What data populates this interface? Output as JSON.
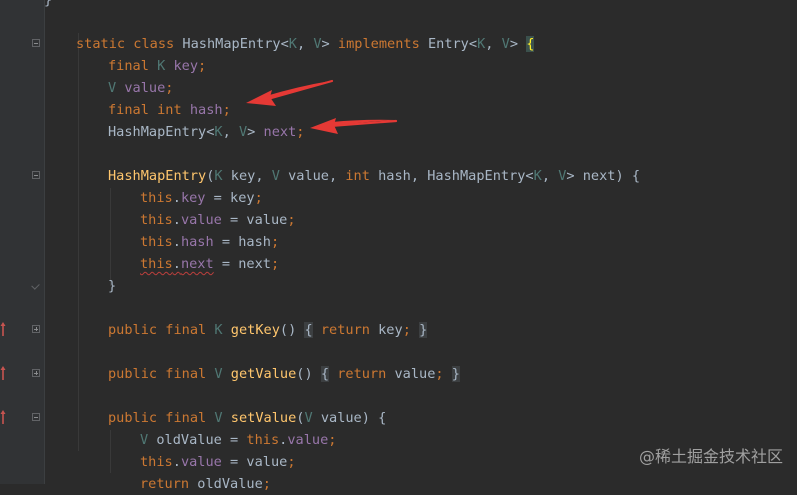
{
  "editor": {
    "language": "java",
    "lines": [
      {
        "tokens": [
          {
            "t": "}",
            "c": "t-brace"
          }
        ]
      },
      {
        "tokens": []
      },
      {
        "fold": "minus",
        "tokens": [
          {
            "t": "static",
            "c": "t-kw"
          },
          {
            "t": " "
          },
          {
            "t": "class",
            "c": "t-kw"
          },
          {
            "t": " HashMapEntry<"
          },
          {
            "t": "K",
            "c": "t-tp"
          },
          {
            "t": ", "
          },
          {
            "t": "V",
            "c": "t-tp"
          },
          {
            "t": "> "
          },
          {
            "t": "implements",
            "c": "t-kw"
          },
          {
            "t": " Entry<"
          },
          {
            "t": "K",
            "c": "t-tp"
          },
          {
            "t": ", "
          },
          {
            "t": "V",
            "c": "t-tp"
          },
          {
            "t": "> "
          },
          {
            "t": "{",
            "c": "t-hl"
          }
        ]
      },
      {
        "tokens": [
          {
            "t": "final",
            "c": "t-kw"
          },
          {
            "t": " "
          },
          {
            "t": "K",
            "c": "t-tp"
          },
          {
            "t": " "
          },
          {
            "t": "key",
            "c": "t-field"
          },
          {
            "t": ";",
            "c": "t-kw"
          }
        ]
      },
      {
        "tokens": [
          {
            "t": "V",
            "c": "t-tp"
          },
          {
            "t": " "
          },
          {
            "t": "value",
            "c": "t-field"
          },
          {
            "t": ";",
            "c": "t-kw"
          }
        ]
      },
      {
        "tokens": [
          {
            "t": "final",
            "c": "t-kw"
          },
          {
            "t": " "
          },
          {
            "t": "int",
            "c": "t-kw"
          },
          {
            "t": " "
          },
          {
            "t": "hash",
            "c": "t-field"
          },
          {
            "t": ";",
            "c": "t-kw"
          }
        ]
      },
      {
        "tokens": [
          {
            "t": "HashMapEntry<"
          },
          {
            "t": "K",
            "c": "t-tp"
          },
          {
            "t": ", "
          },
          {
            "t": "V",
            "c": "t-tp"
          },
          {
            "t": "> "
          },
          {
            "t": "next",
            "c": "t-field"
          },
          {
            "t": ";",
            "c": "t-kw"
          }
        ]
      },
      {
        "tokens": []
      },
      {
        "fold": "minus",
        "tokens": [
          {
            "t": "HashMapEntry",
            "c": "t-fn"
          },
          {
            "t": "("
          },
          {
            "t": "K",
            "c": "t-tp"
          },
          {
            "t": " key, "
          },
          {
            "t": "V",
            "c": "t-tp"
          },
          {
            "t": " value, "
          },
          {
            "t": "int",
            "c": "t-kw"
          },
          {
            "t": " hash, HashMapEntry<"
          },
          {
            "t": "K",
            "c": "t-tp"
          },
          {
            "t": ", "
          },
          {
            "t": "V",
            "c": "t-tp"
          },
          {
            "t": "> next) {"
          }
        ]
      },
      {
        "tokens": [
          {
            "t": "this",
            "c": "t-kw"
          },
          {
            "t": "."
          },
          {
            "t": "key",
            "c": "t-field"
          },
          {
            "t": " = key"
          },
          {
            "t": ";",
            "c": "t-kw"
          }
        ]
      },
      {
        "tokens": [
          {
            "t": "this",
            "c": "t-kw"
          },
          {
            "t": "."
          },
          {
            "t": "value",
            "c": "t-field"
          },
          {
            "t": " = value"
          },
          {
            "t": ";",
            "c": "t-kw"
          }
        ]
      },
      {
        "tokens": [
          {
            "t": "this",
            "c": "t-kw"
          },
          {
            "t": "."
          },
          {
            "t": "hash",
            "c": "t-field"
          },
          {
            "t": " = hash"
          },
          {
            "t": ";",
            "c": "t-kw"
          }
        ]
      },
      {
        "tokens": [
          {
            "t": "this.next",
            "c": "t-kw squiggle-mix"
          },
          {
            "t": " = next"
          },
          {
            "t": ";",
            "c": "t-kw"
          }
        ]
      },
      {
        "fold": "end",
        "tokens": [
          {
            "t": "}"
          }
        ]
      },
      {
        "tokens": []
      },
      {
        "fold": "plus",
        "override": true,
        "tokens": [
          {
            "t": "public",
            "c": "t-kw"
          },
          {
            "t": " "
          },
          {
            "t": "final",
            "c": "t-kw"
          },
          {
            "t": " "
          },
          {
            "t": "K",
            "c": "t-tp"
          },
          {
            "t": " "
          },
          {
            "t": "getKey",
            "c": "t-fn"
          },
          {
            "t": "() "
          },
          {
            "t": "{",
            "c": "t-ghost"
          },
          {
            "t": " "
          },
          {
            "t": "return",
            "c": "t-kw"
          },
          {
            "t": " key"
          },
          {
            "t": ";",
            "c": "t-kw"
          },
          {
            "t": " "
          },
          {
            "t": "}",
            "c": "t-ghost"
          }
        ]
      },
      {
        "tokens": []
      },
      {
        "fold": "plus",
        "override": true,
        "tokens": [
          {
            "t": "public",
            "c": "t-kw"
          },
          {
            "t": " "
          },
          {
            "t": "final",
            "c": "t-kw"
          },
          {
            "t": " "
          },
          {
            "t": "V",
            "c": "t-tp"
          },
          {
            "t": " "
          },
          {
            "t": "getValue",
            "c": "t-fn"
          },
          {
            "t": "() "
          },
          {
            "t": "{",
            "c": "t-ghost"
          },
          {
            "t": " "
          },
          {
            "t": "return",
            "c": "t-kw"
          },
          {
            "t": " value"
          },
          {
            "t": ";",
            "c": "t-kw"
          },
          {
            "t": " "
          },
          {
            "t": "}",
            "c": "t-ghost"
          }
        ]
      },
      {
        "tokens": []
      },
      {
        "fold": "minus",
        "override": true,
        "tokens": [
          {
            "t": "public",
            "c": "t-kw"
          },
          {
            "t": " "
          },
          {
            "t": "final",
            "c": "t-kw"
          },
          {
            "t": " "
          },
          {
            "t": "V",
            "c": "t-tp"
          },
          {
            "t": " "
          },
          {
            "t": "setValue",
            "c": "t-fn"
          },
          {
            "t": "("
          },
          {
            "t": "V",
            "c": "t-tp"
          },
          {
            "t": " value) {"
          }
        ]
      },
      {
        "tokens": [
          {
            "t": "V",
            "c": "t-tp"
          },
          {
            "t": " oldValue = "
          },
          {
            "t": "this",
            "c": "t-kw"
          },
          {
            "t": "."
          },
          {
            "t": "value",
            "c": "t-field"
          },
          {
            "t": ";",
            "c": "t-kw"
          }
        ]
      },
      {
        "tokens": [
          {
            "t": "this",
            "c": "t-kw"
          },
          {
            "t": "."
          },
          {
            "t": "value",
            "c": "t-field"
          },
          {
            "t": " = value"
          },
          {
            "t": ";",
            "c": "t-kw"
          }
        ]
      },
      {
        "tokens": [
          {
            "t": "return",
            "c": "t-kw"
          },
          {
            "t": " oldValue"
          },
          {
            "t": ";",
            "c": "t-kw"
          }
        ]
      }
    ]
  },
  "watermark": "@稀土掘金技术社区",
  "colors": {
    "background": "#2b2b2b",
    "keyword": "#cc7832",
    "field": "#9876aa",
    "method": "#ffc66d",
    "type_param": "#507874",
    "annotation_arrow": "#e53935",
    "override_marker": "#c75450"
  }
}
